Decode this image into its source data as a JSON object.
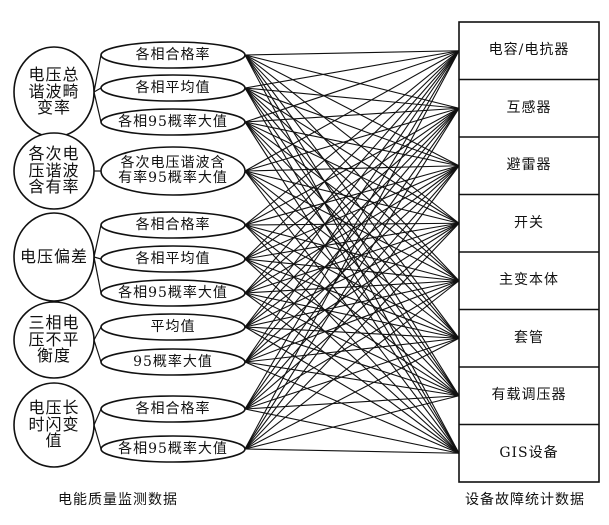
{
  "power_quality": {
    "caption": "电能质量监测数据",
    "categories": [
      {
        "label": "电压总\n谐波畸\n变率",
        "indicators": [
          0,
          1,
          2
        ]
      },
      {
        "label": "各次电\n压谐波\n含有率",
        "indicators": [
          3
        ]
      },
      {
        "label": "电压偏差",
        "indicators": [
          4,
          5,
          6
        ]
      },
      {
        "label": "三相电\n压不平\n衡度",
        "indicators": [
          7,
          8
        ]
      },
      {
        "label": "电压长\n时闪变\n值",
        "indicators": [
          9,
          10
        ]
      }
    ],
    "indicators": [
      {
        "label": "各相合格率"
      },
      {
        "label": "各相平均值"
      },
      {
        "label": "各相95概率大值"
      },
      {
        "label": "各次电压谐波含\n有率95概率大值"
      },
      {
        "label": "各相合格率"
      },
      {
        "label": "各相平均值"
      },
      {
        "label": "各相95概率大值"
      },
      {
        "label": "平均值"
      },
      {
        "label": "95概率大值"
      },
      {
        "label": "各相合格率"
      },
      {
        "label": "各相95概率大值"
      }
    ]
  },
  "fault_stats": {
    "caption": "设备故障统计数据",
    "devices": [
      {
        "label": "电容/电抗器"
      },
      {
        "label": "互感器"
      },
      {
        "label": "避雷器"
      },
      {
        "label": "开关"
      },
      {
        "label": "主变本体"
      },
      {
        "label": "套管"
      },
      {
        "label": "有载调压器"
      },
      {
        "label": "GIS设备"
      }
    ]
  },
  "connections": "all-to-all"
}
